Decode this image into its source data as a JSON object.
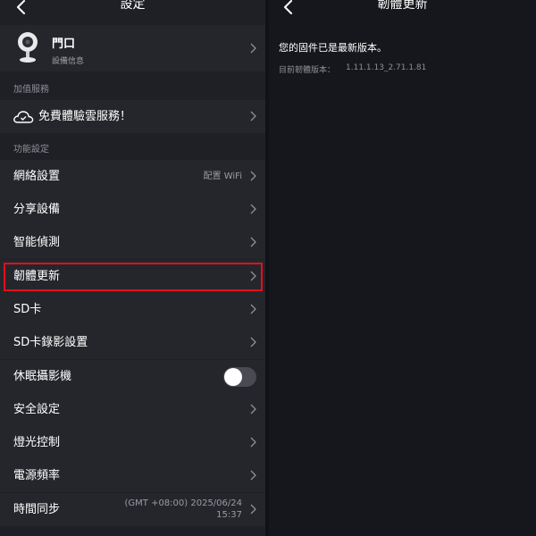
{
  "left_panel": {
    "header_title": "設定",
    "device": {
      "name": "門口",
      "subtitle": "設備信息"
    },
    "section_value_added": "加值服務",
    "cloud_service_label": "免費體驗雲服務！",
    "section_functions": "功能設定",
    "items": [
      {
        "label": "網絡設置",
        "value": "配置 WiFi"
      },
      {
        "label": "分享設備"
      },
      {
        "label": "智能偵測"
      },
      {
        "label": "韌體更新"
      },
      {
        "label": "SD卡"
      },
      {
        "label": "SD卡錄影設置"
      },
      {
        "label": "休眠攝影機",
        "toggle": false
      },
      {
        "label": " 安全設定"
      },
      {
        "label": "燈光控制"
      },
      {
        "label": "電源頻率"
      },
      {
        "label": "時間同步",
        "value_line1": "(GMT +08:00) 2025/06/24",
        "value_line2": "15:37"
      }
    ]
  },
  "right_panel": {
    "header_title": "韌體更新",
    "status_text": "您的固件已是最新版本。",
    "version_label": "目前韌體版本：",
    "version_value": "1.11.1.13_2.71.1.81"
  },
  "colors": {
    "highlight": "#e0101a",
    "panel_bg": "#1f2026",
    "row_bg": "#25262c",
    "page_bg": "#16171c"
  },
  "icons": {
    "back": "chevron-left-icon",
    "row_arrow": "chevron-right-icon",
    "device": "camera-icon",
    "cloud": "cloud-icon"
  }
}
